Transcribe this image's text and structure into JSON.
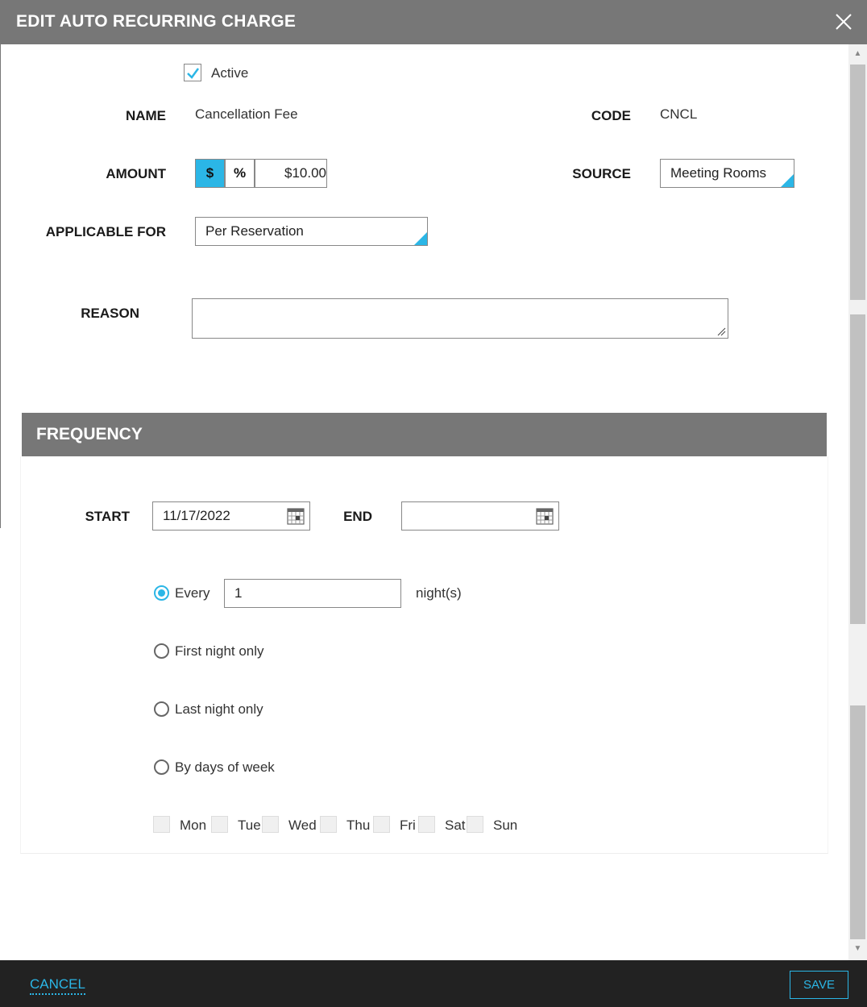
{
  "dialog": {
    "title": "EDIT AUTO RECURRING CHARGE"
  },
  "active": {
    "label": "Active",
    "checked": true
  },
  "name": {
    "label": "NAME",
    "value": "Cancellation Fee"
  },
  "code": {
    "label": "CODE",
    "value": "CNCL"
  },
  "amount": {
    "label": "AMOUNT",
    "dollar_label": "$",
    "percent_label": "%",
    "value": "$10.00",
    "selected": "$"
  },
  "source": {
    "label": "SOURCE",
    "value": "Meeting Rooms"
  },
  "applicable_for": {
    "label": "APPLICABLE FOR",
    "value": "Per Reservation"
  },
  "reason": {
    "label": "REASON",
    "value": ""
  },
  "frequency": {
    "title": "FREQUENCY",
    "start_label": "START",
    "start_value": "11/17/2022",
    "end_label": "END",
    "end_value": "",
    "every_label": "Every",
    "every_value": "1",
    "every_unit": "night(s)",
    "first_night_label": "First night only",
    "last_night_label": "Last night only",
    "by_days_label": "By days of week",
    "selected_option": "every",
    "days": [
      "Mon",
      "Tue",
      "Wed",
      "Thu",
      "Fri",
      "Sat",
      "Sun"
    ]
  },
  "footer": {
    "cancel_label": "CANCEL",
    "save_label": "SAVE"
  },
  "colors": {
    "accent": "#2bb6e6",
    "header": "#777777",
    "footer": "#222222"
  },
  "icons": [
    "close-icon",
    "checkmark-icon",
    "calendar-icon",
    "dropdown-corner-icon",
    "resize-handle-icon"
  ]
}
